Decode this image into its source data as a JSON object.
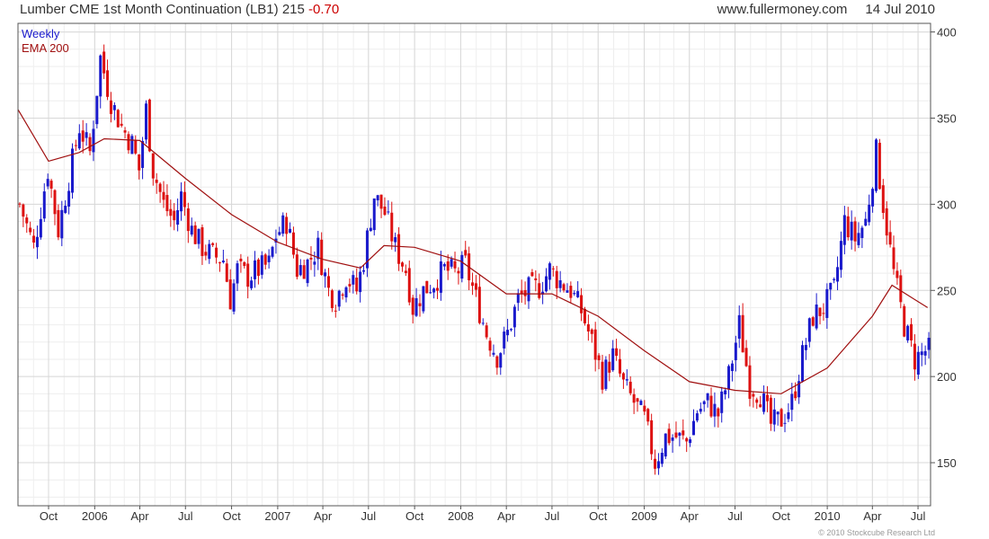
{
  "header": {
    "instrument": "Lumber CME 1st Month Continuation (LB1)",
    "last": "215",
    "change": "-0.70",
    "site": "www.fullermoney.com",
    "date": "14 Jul 2010"
  },
  "legend": {
    "series1": "Weekly",
    "series2": "EMA 200"
  },
  "footer": "© 2010 Stockcube Research Ltd",
  "colors": {
    "up": "#1a1acc",
    "down": "#dd1111",
    "ema": "#a01010",
    "grid": "#d8d8d8",
    "axis": "#555555"
  },
  "chart_data": {
    "type": "candlestick",
    "title": "Lumber CME 1st Month Continuation (LB1)",
    "frequency": "Weekly",
    "ylim": [
      125,
      405
    ],
    "yticks": [
      150,
      200,
      250,
      300,
      350,
      400
    ],
    "xlim": [
      "2005-08-01",
      "2010-07-26"
    ],
    "xticks": [
      {
        "label": "Oct",
        "date": "2005-10-01"
      },
      {
        "label": "2006",
        "date": "2006-01-01"
      },
      {
        "label": "Apr",
        "date": "2006-04-01"
      },
      {
        "label": "Jul",
        "date": "2006-07-01"
      },
      {
        "label": "Oct",
        "date": "2006-10-01"
      },
      {
        "label": "2007",
        "date": "2007-01-01"
      },
      {
        "label": "Apr",
        "date": "2007-04-01"
      },
      {
        "label": "Jul",
        "date": "2007-07-01"
      },
      {
        "label": "Oct",
        "date": "2007-10-01"
      },
      {
        "label": "2008",
        "date": "2008-01-01"
      },
      {
        "label": "Apr",
        "date": "2008-04-01"
      },
      {
        "label": "Jul",
        "date": "2008-07-01"
      },
      {
        "label": "Oct",
        "date": "2008-10-01"
      },
      {
        "label": "2009",
        "date": "2009-01-01"
      },
      {
        "label": "Apr",
        "date": "2009-04-01"
      },
      {
        "label": "Jul",
        "date": "2009-07-01"
      },
      {
        "label": "Oct",
        "date": "2009-10-01"
      },
      {
        "label": "2010",
        "date": "2010-01-01"
      },
      {
        "label": "Apr",
        "date": "2010-04-01"
      },
      {
        "label": "Jul",
        "date": "2010-07-01"
      }
    ],
    "close_path": [
      [
        "2005-08-01",
        300
      ],
      [
        "2005-08-29",
        275
      ],
      [
        "2005-09-26",
        320
      ],
      [
        "2005-10-17",
        285
      ],
      [
        "2005-11-07",
        315
      ],
      [
        "2005-11-28",
        345
      ],
      [
        "2005-12-19",
        330
      ],
      [
        "2006-01-09",
        385
      ],
      [
        "2006-01-30",
        360
      ],
      [
        "2006-02-20",
        345
      ],
      [
        "2006-03-13",
        335
      ],
      [
        "2006-03-27",
        320
      ],
      [
        "2006-04-10",
        355
      ],
      [
        "2006-04-24",
        320
      ],
      [
        "2006-05-15",
        300
      ],
      [
        "2006-06-05",
        290
      ],
      [
        "2006-06-19",
        305
      ],
      [
        "2006-07-10",
        285
      ],
      [
        "2006-07-31",
        275
      ],
      [
        "2006-08-21",
        270
      ],
      [
        "2006-09-11",
        268
      ],
      [
        "2006-09-25",
        245
      ],
      [
        "2006-10-09",
        262
      ],
      [
        "2006-10-30",
        258
      ],
      [
        "2006-11-20",
        262
      ],
      [
        "2006-12-11",
        265
      ],
      [
        "2006-12-25",
        282
      ],
      [
        "2007-01-15",
        290
      ],
      [
        "2007-02-05",
        262
      ],
      [
        "2007-02-26",
        266
      ],
      [
        "2007-03-19",
        275
      ],
      [
        "2007-04-09",
        250
      ],
      [
        "2007-04-23",
        245
      ],
      [
        "2007-05-14",
        258
      ],
      [
        "2007-06-04",
        250
      ],
      [
        "2007-06-18",
        268
      ],
      [
        "2007-07-09",
        305
      ],
      [
        "2007-07-30",
        295
      ],
      [
        "2007-08-20",
        275
      ],
      [
        "2007-09-10",
        262
      ],
      [
        "2007-09-24",
        240
      ],
      [
        "2007-10-15",
        250
      ],
      [
        "2007-11-05",
        255
      ],
      [
        "2007-11-26",
        262
      ],
      [
        "2007-12-17",
        260
      ],
      [
        "2008-01-07",
        265
      ],
      [
        "2008-01-28",
        245
      ],
      [
        "2008-02-18",
        225
      ],
      [
        "2008-03-10",
        212
      ],
      [
        "2008-03-31",
        225
      ],
      [
        "2008-04-21",
        245
      ],
      [
        "2008-05-12",
        250
      ],
      [
        "2008-06-02",
        252
      ],
      [
        "2008-06-23",
        262
      ],
      [
        "2008-07-14",
        255
      ],
      [
        "2008-08-04",
        250
      ],
      [
        "2008-08-25",
        238
      ],
      [
        "2008-09-15",
        220
      ],
      [
        "2008-10-06",
        200
      ],
      [
        "2008-10-27",
        212
      ],
      [
        "2008-11-17",
        195
      ],
      [
        "2008-12-08",
        185
      ],
      [
        "2008-12-29",
        175
      ],
      [
        "2009-01-19",
        150
      ],
      [
        "2009-02-09",
        165
      ],
      [
        "2009-03-02",
        165
      ],
      [
        "2009-03-23",
        162
      ],
      [
        "2009-04-13",
        180
      ],
      [
        "2009-05-04",
        185
      ],
      [
        "2009-05-25",
        178
      ],
      [
        "2009-06-15",
        200
      ],
      [
        "2009-07-06",
        230
      ],
      [
        "2009-07-27",
        195
      ],
      [
        "2009-08-17",
        190
      ],
      [
        "2009-09-07",
        172
      ],
      [
        "2009-09-28",
        175
      ],
      [
        "2009-10-19",
        185
      ],
      [
        "2009-11-09",
        212
      ],
      [
        "2009-11-30",
        235
      ],
      [
        "2009-12-21",
        240
      ],
      [
        "2010-01-11",
        250
      ],
      [
        "2010-02-01",
        290
      ],
      [
        "2010-02-22",
        280
      ],
      [
        "2010-03-15",
        290
      ],
      [
        "2010-04-05",
        330
      ],
      [
        "2010-04-19",
        300
      ],
      [
        "2010-05-10",
        260
      ],
      [
        "2010-05-31",
        230
      ],
      [
        "2010-06-21",
        210
      ],
      [
        "2010-07-12",
        215
      ]
    ],
    "ema_200": [
      [
        "2005-08-01",
        355
      ],
      [
        "2005-10-01",
        325
      ],
      [
        "2005-12-01",
        330
      ],
      [
        "2006-01-20",
        338
      ],
      [
        "2006-04-01",
        337
      ],
      [
        "2006-07-01",
        315
      ],
      [
        "2006-10-01",
        294
      ],
      [
        "2007-01-01",
        278
      ],
      [
        "2007-04-01",
        268
      ],
      [
        "2007-06-15",
        263
      ],
      [
        "2007-08-01",
        276
      ],
      [
        "2007-10-01",
        275
      ],
      [
        "2008-01-01",
        267
      ],
      [
        "2008-04-01",
        248
      ],
      [
        "2008-07-01",
        248
      ],
      [
        "2008-10-01",
        235
      ],
      [
        "2009-01-01",
        215
      ],
      [
        "2009-04-01",
        197
      ],
      [
        "2009-07-01",
        192
      ],
      [
        "2009-10-01",
        190
      ],
      [
        "2010-01-01",
        205
      ],
      [
        "2010-04-01",
        235
      ],
      [
        "2010-05-10",
        253
      ],
      [
        "2010-07-20",
        240
      ]
    ],
    "grid": true,
    "legend_position": "top-left"
  }
}
